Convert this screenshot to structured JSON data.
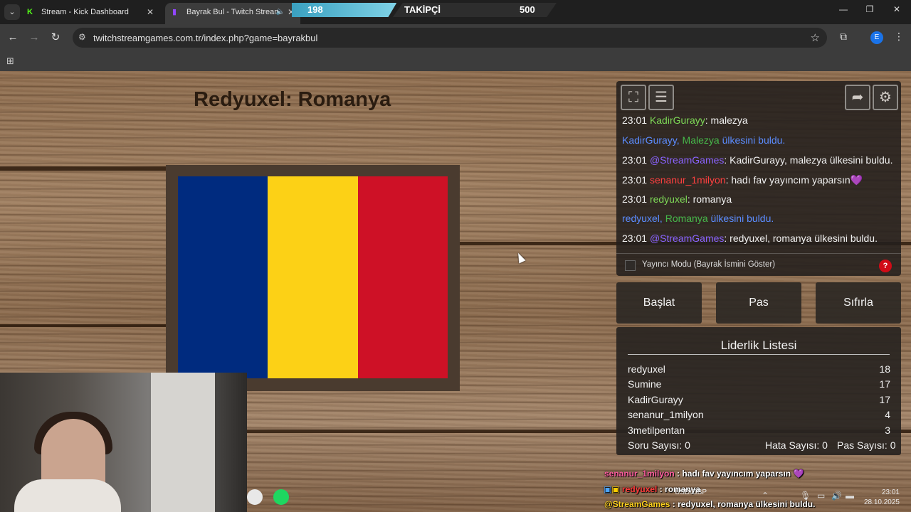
{
  "tabs": [
    {
      "title": "Stream - Kick Dashboard",
      "favicon": "kick-logo"
    },
    {
      "title": "Bayrak Bul - Twitch Stream",
      "favicon": "twitch-logo",
      "audio": "speaker-icon"
    }
  ],
  "follow_overlay": {
    "current": "198",
    "label": "TAKİPÇİ",
    "goal": "500",
    "progress_fraction": 0.396
  },
  "browser": {
    "url": "twitchstreamgames.com.tr/index.php?game=bayrakbul",
    "profile_letter": "E"
  },
  "game": {
    "title": "Redyuxel: Romanya",
    "flag_colors": [
      "#002b7f",
      "#fcd116",
      "#ce1126"
    ]
  },
  "chat": [
    {
      "time": "23:01",
      "user": "KadirGurayy",
      "user_color": "#7ed957",
      "text": ": malezya"
    },
    {
      "system": true,
      "user": "KadirGurayy, ",
      "country": "Malezya",
      "text": " ülkesini buldu."
    },
    {
      "time": "23:01",
      "user": "@StreamGames",
      "user_color": "#8a63ff",
      "text": ": KadirGurayy, malezya ülkesini buldu."
    },
    {
      "time": "23:01",
      "user": "senanur_1milyon",
      "user_color": "#ff4040",
      "text": ": hadı fav yayıncım yaparsın",
      "emote": "💜"
    },
    {
      "time": "23:01",
      "user": "redyuxel",
      "user_color": "#7ed957",
      "text": ": romanya"
    },
    {
      "system": true,
      "user": "redyuxel, ",
      "country": "Romanya",
      "text": " ülkesini buldu."
    },
    {
      "time": "23:01",
      "user": "@StreamGames",
      "user_color": "#8a63ff",
      "text": ": redyuxel, romanya ülkesini buldu."
    }
  ],
  "streamer_mode_label": "Yayıncı Modu (Bayrak İsmini Göster)",
  "help_label": "?",
  "buttons": {
    "start": "Başlat",
    "pass": "Pas",
    "reset": "Sıfırla"
  },
  "leaderboard": {
    "title": "Liderlik Listesi",
    "rows": [
      {
        "name": "redyuxel",
        "score": "18"
      },
      {
        "name": "Sumine",
        "score": "17"
      },
      {
        "name": "KadirGurayy",
        "score": "17"
      },
      {
        "name": "senanur_1milyon",
        "score": "4"
      },
      {
        "name": "3metilpentan",
        "score": "3"
      }
    ],
    "question_count": "Soru Sayısı: 0",
    "error_count": "Hata Sayısı: 0",
    "pass_count": "Pas Sayısı: 0"
  },
  "overlay_chat": [
    {
      "user": "senanur_1milyon",
      "text": " : hadı fav yayıncım yaparsın",
      "color": "#ff5fa0"
    },
    {
      "user": "redyuxel",
      "text": " : romanya",
      "color": "#ff3b3b"
    },
    {
      "user": "@StreamGames",
      "text": " : redyuxel, romanya ülkesini buldu.",
      "color": "#ffd21f"
    }
  ],
  "tray": {
    "currency": "USD/GBP",
    "time": "23:01",
    "date": "28.10.2025"
  }
}
